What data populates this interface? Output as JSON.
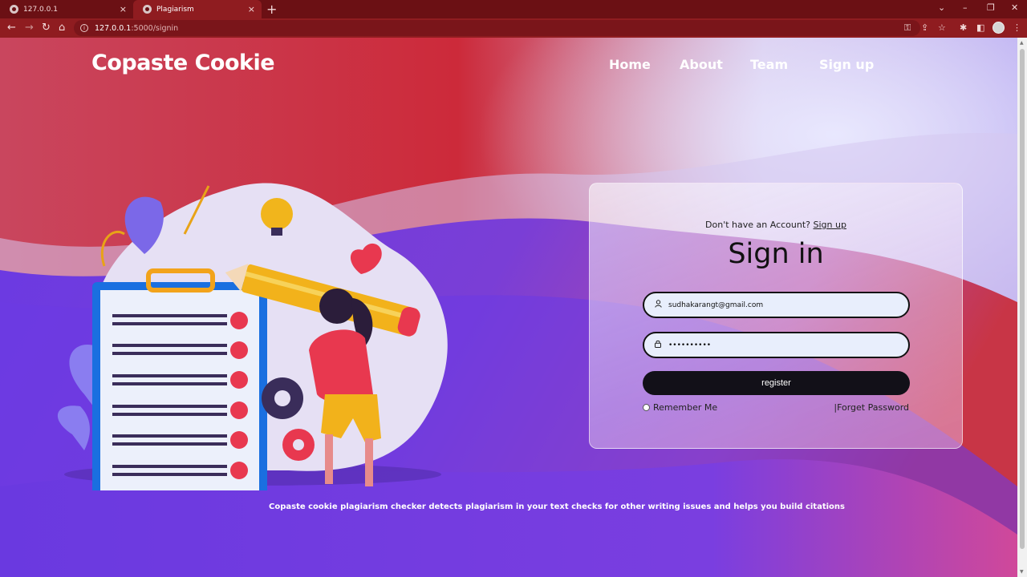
{
  "browser": {
    "tabs": [
      {
        "title": "127.0.0.1",
        "active": false
      },
      {
        "title": "Plagiarism",
        "active": true
      }
    ],
    "url_host": "127.0.0.1",
    "url_path": ":5000/signin",
    "icons": {
      "close": "×",
      "new_tab": "+",
      "back": "←",
      "forward": "→",
      "reload": "↻",
      "home": "⌂",
      "info": "i",
      "key": "⚿",
      "share": "⇪",
      "star": "☆",
      "extensions": "✱",
      "sidepanel": "◧",
      "menu": "⋮",
      "tab_search": "⌄",
      "minimize": "–",
      "restore": "❐",
      "close_window": "✕"
    }
  },
  "site": {
    "brand": "Copaste Cookie",
    "nav": [
      "Home",
      "About",
      "Team",
      "Sign up"
    ]
  },
  "signin": {
    "no_account_text": "Don't have an Account?",
    "signup_link": "Sign up",
    "title": "Sign in",
    "email_value": "sudhakarangt@gmail.com",
    "password_value": "••••••••••",
    "submit_label": "register",
    "remember_label": "Remember Me",
    "forget_label": "|Forget Password",
    "icons": {
      "user": "user-icon",
      "lock": "lock-icon"
    }
  },
  "footer": {
    "tagline": "Copaste cookie plagiarism checker detects plagiarism in your text checks for other writing issues and helps you build citations"
  },
  "colors": {
    "chrome": "#6b1014",
    "toolbar": "#8f1c20",
    "accent_red": "#c92b3a",
    "accent_purple": "#6c3ae0",
    "button": "#121018"
  }
}
